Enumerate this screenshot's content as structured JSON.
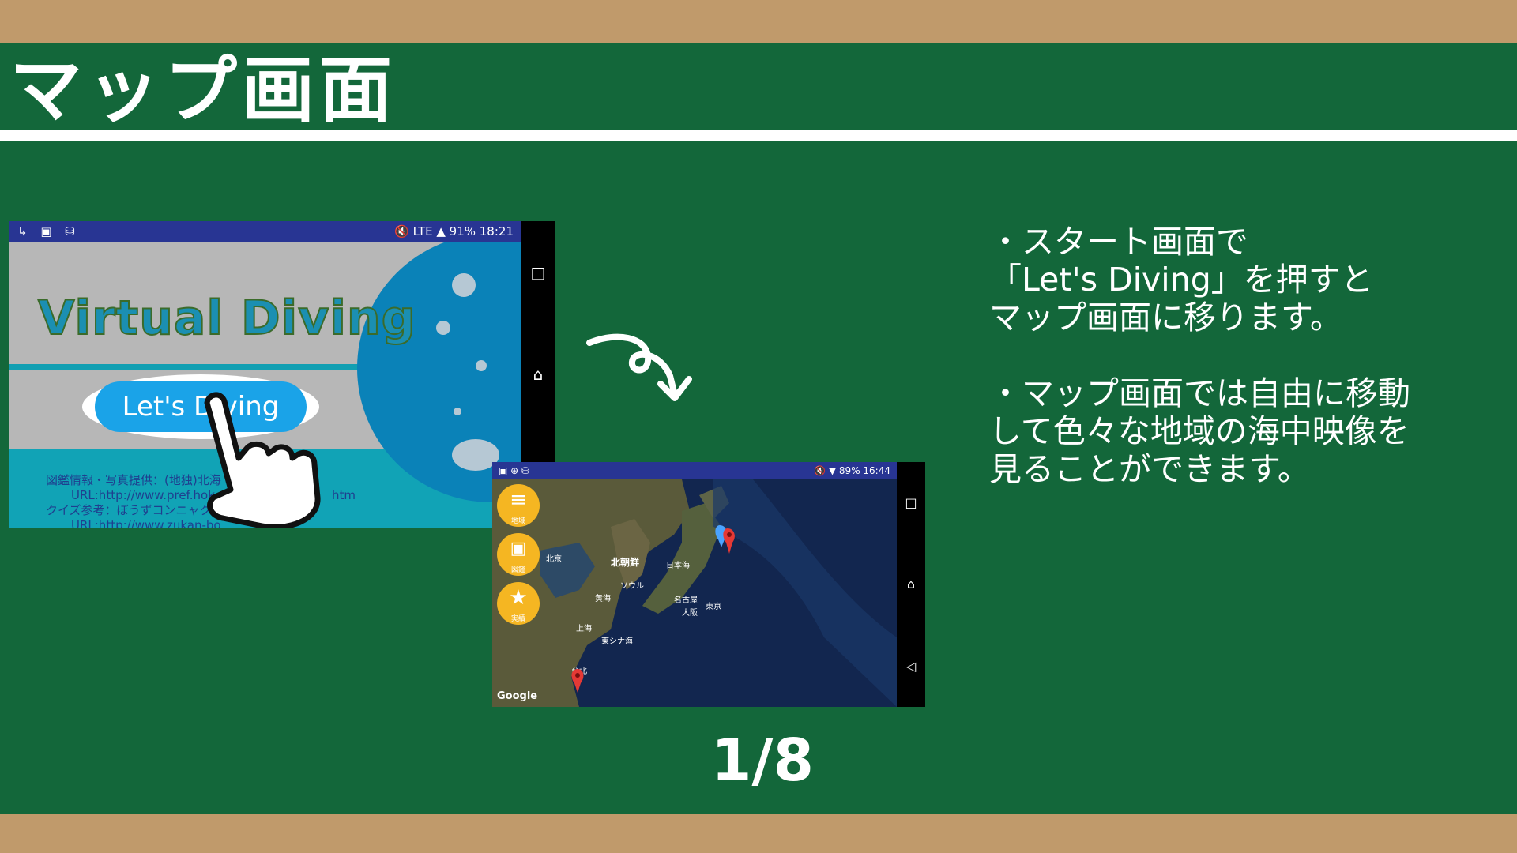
{
  "header": {
    "title": "マップ画面"
  },
  "start_screen": {
    "status_bar": {
      "left_icons": "↳ ▣ ⛁",
      "right": "🔇 LTE ▲ 91% 18:21"
    },
    "app_title": "Virtual Diving",
    "button_label": "Let's Diving",
    "credits": [
      "図鑑情報・写真提供：(地独)北海",
      "URL:http://www.pref.hok",
      "クイズ参考：ぼうずコンニャクの市場",
      "URL:http://www.zukan-bo",
      "htm"
    ]
  },
  "map_screen": {
    "status_bar": {
      "right": "🔇 ▼ 89% 16:44"
    },
    "buttons": [
      {
        "label": "地域",
        "icon": "list-icon"
      },
      {
        "label": "図鑑",
        "icon": "book-icon"
      },
      {
        "label": "実績",
        "icon": "star-icon"
      }
    ],
    "labels": {
      "north_korea": "北朝鮮",
      "sea_of_japan": "日本海",
      "nagoya": "名古屋",
      "tokyo": "東京",
      "osaka": "大阪",
      "seoul": "ソウル",
      "yellow_sea": "黄海",
      "shanghai": "上海",
      "east_china_sea": "東シナ海",
      "taipei": "台北",
      "beijing": "北京"
    },
    "google": "Google"
  },
  "description": {
    "line1": "・スタート画面で",
    "line2": "「Let's Diving」を押すと",
    "line3": "マップ画面に移ります。",
    "line4": "・マップ画面では自由に移動",
    "line5": "して色々な地域の海中映像を",
    "line6": "見ることができます。"
  },
  "pager": "1/8"
}
